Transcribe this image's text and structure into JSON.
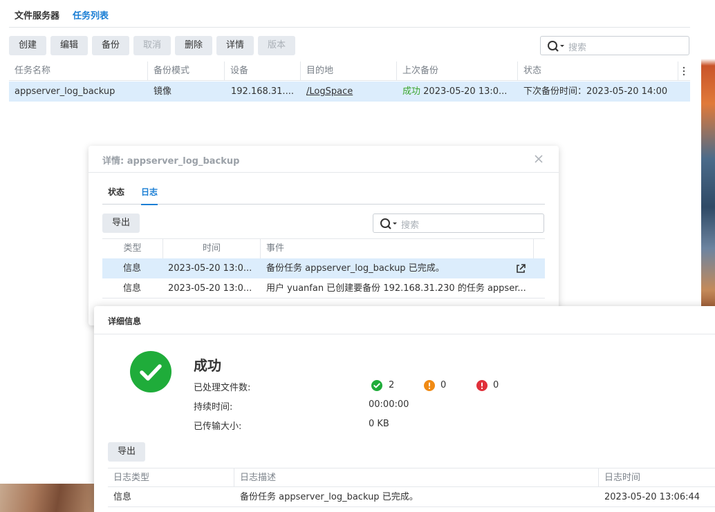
{
  "main": {
    "tabs": [
      {
        "label": "文件服务器"
      },
      {
        "label": "任务列表"
      }
    ],
    "toolbar": {
      "create": "创建",
      "edit": "编辑",
      "backup": "备份",
      "cancel": "取消",
      "delete": "删除",
      "details": "详情",
      "version": "版本"
    },
    "search_placeholder": "搜索",
    "columns": [
      "任务名称",
      "备份模式",
      "设备",
      "目的地",
      "上次备份",
      "状态"
    ],
    "rows": [
      {
        "name": "appserver_log_backup",
        "mode": "镜像",
        "device": "192.168.31....",
        "destination": "/LogSpace",
        "last_status": "成功",
        "last_time": "2023-05-20 13:0...",
        "state": "下次备份时间：2023-05-20 14:00"
      }
    ]
  },
  "details_dialog": {
    "title": "详情: appserver_log_backup",
    "tabs": [
      {
        "label": "状态"
      },
      {
        "label": "日志"
      }
    ],
    "export_label": "导出",
    "search_placeholder": "搜索",
    "columns": [
      "类型",
      "时间",
      "事件"
    ],
    "rows": [
      {
        "type": "信息",
        "time": "2023-05-20 13:0...",
        "event": "备份任务 appserver_log_backup 已完成。"
      },
      {
        "type": "信息",
        "time": "2023-05-20 13:0...",
        "event": "用户 yuanfan 已创建要备份 192.168.31.230 的任务 appser..."
      }
    ]
  },
  "info_dialog": {
    "title": "详细信息",
    "result": "成功",
    "files_label": "已处理文件数:",
    "success_count": "2",
    "warning_count": "0",
    "error_count": "0",
    "duration_label": "持续时间:",
    "duration": "00:00:00",
    "size_label": "已传输大小:",
    "size": "0 KB",
    "export_label": "导出",
    "columns": [
      "日志类型",
      "日志描述",
      "日志时间"
    ],
    "rows": [
      {
        "type": "信息",
        "desc": "备份任务 appserver_log_backup 已完成。",
        "time": "2023-05-20 13:06:44"
      }
    ]
  },
  "colors": {
    "accent": "#1a7ed4",
    "success": "#1fac3a",
    "warning": "#f08a14",
    "error": "#e0303a",
    "selected_row": "#dcedfc"
  }
}
